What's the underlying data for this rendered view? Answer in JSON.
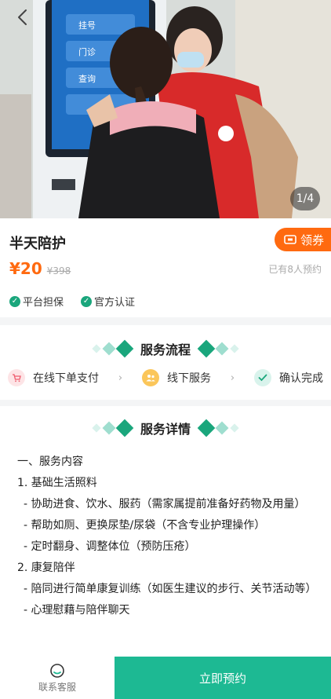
{
  "hero": {
    "pager": "1/4",
    "kiosk_buttons": [
      "挂号",
      "门诊",
      "查询"
    ]
  },
  "product": {
    "title": "半天陪护",
    "coupon_label": "领券",
    "price": "¥20",
    "original_price": "¥398",
    "booked_text": "已有8人预约",
    "guarantees": [
      "平台担保",
      "官方认证"
    ]
  },
  "process": {
    "title": "服务流程",
    "steps": [
      "在线下单支付",
      "线下服务",
      "确认完成"
    ]
  },
  "detail": {
    "title": "服务详情",
    "lines": [
      "一、服务内容",
      "1. 基础生活照料",
      "- 协助进食、饮水、服药（需家属提前准备好药物及用量）",
      "- 帮助如厕、更换尿垫/尿袋（不含专业护理操作）",
      "- 定时翻身、调整体位（预防压疮）",
      "2. 康复陪伴",
      "- 陪同进行简单康复训练（如医生建议的步行、关节活动等）",
      "- 心理慰藉与陪伴聊天"
    ]
  },
  "bottom": {
    "service_label": "联系客服",
    "book_label": "立即预约"
  },
  "colors": {
    "accent": "#1db993",
    "orange": "#ff6a10",
    "green": "#1aa67c"
  }
}
